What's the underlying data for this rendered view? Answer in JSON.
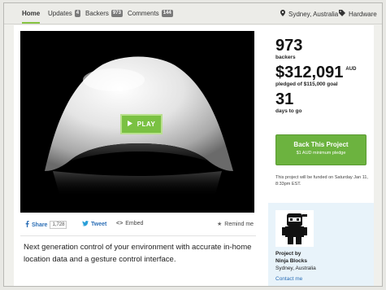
{
  "nav": {
    "tabs": [
      {
        "label": "Home",
        "badge": ""
      },
      {
        "label": "Updates",
        "badge": "4"
      },
      {
        "label": "Backers",
        "badge": "973"
      },
      {
        "label": "Comments",
        "badge": "144"
      }
    ],
    "location": "Sydney, Australia",
    "category": "Hardware",
    "location_icon": "map-pin-icon",
    "category_icon": "tag-icon"
  },
  "video": {
    "play_label": "PLAY"
  },
  "share": {
    "share_label": "Share",
    "share_count": "1,728",
    "tweet_label": "Tweet",
    "embed_label": "Embed",
    "remind_label": "Remind me"
  },
  "blurb": "Next generation control of your environment with accurate in-home location data and a gesture control interface.",
  "stats": {
    "backers_count": "973",
    "backers_label": "backers",
    "pledged_amount": "$312,091",
    "pledged_currency": "AUD",
    "pledged_label": "pledged of $115,000 goal",
    "days_count": "31",
    "days_label": "days to go"
  },
  "back_button": {
    "title": "Back This Project",
    "subtitle": "$1 AUD minimum pledge"
  },
  "funded_note": "This project will be funded on Saturday Jan 11, 8:33pm EST.",
  "creator": {
    "project_by_label": "Project by",
    "name": "Ninja Blocks",
    "location": "Sydney, Australia",
    "contact_label": "Contact me"
  },
  "colors": {
    "accent_green": "#6cb33f",
    "link_blue": "#2a6db5",
    "creator_bg": "#e8f3fa"
  }
}
